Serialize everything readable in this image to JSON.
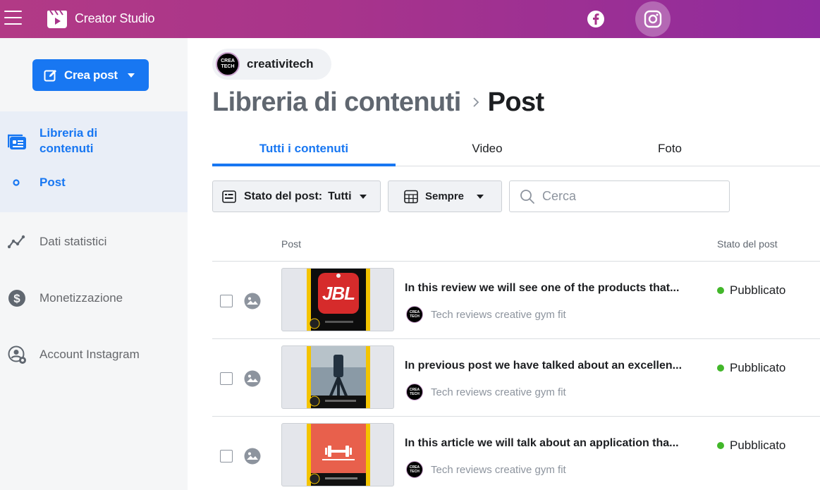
{
  "app": {
    "title": "Creator Studio"
  },
  "topbar": {
    "platforms": [
      "facebook-icon",
      "instagram-icon"
    ],
    "active_platform": "instagram"
  },
  "colors": {
    "topbar_start": "#b23a86",
    "topbar_end": "#8f2b9e",
    "accent": "#1877f2",
    "published": "#42b72a"
  },
  "sidebar": {
    "create_button": "Crea post",
    "items": [
      {
        "label": "Libreria di contenuti",
        "icon": "library-icon"
      },
      {
        "label": "Post",
        "icon": "dot-icon"
      },
      {
        "label": "Dati statistici",
        "icon": "insights-icon"
      },
      {
        "label": "Monetizzazione",
        "icon": "dollar-icon"
      },
      {
        "label": "Account Instagram",
        "icon": "account-settings-icon"
      }
    ]
  },
  "page": {
    "name": "creativitech",
    "avatar_text": "CREA TECH"
  },
  "breadcrumb": {
    "parent": "Libreria di contenuti",
    "current": "Post"
  },
  "tabs": [
    {
      "label": "Tutti i contenuti",
      "active": true
    },
    {
      "label": "Video",
      "active": false
    },
    {
      "label": "Foto",
      "active": false
    }
  ],
  "filters": {
    "status_label": "Stato del post:",
    "status_value": "Tutti",
    "date_value": "Sempre",
    "search_placeholder": "Cerca"
  },
  "table": {
    "columns": [
      "Post",
      "Stato del post"
    ],
    "rows": [
      {
        "title": "In this review we will see one of the products that...",
        "author": "Tech reviews creative gym fit",
        "status": "Pubblicato",
        "poster_text": "JBL"
      },
      {
        "title": "In previous post we have talked about an excellen...",
        "author": "Tech reviews creative gym fit",
        "status": "Pubblicato",
        "poster_text": ""
      },
      {
        "title": "In this article we will talk about an application tha...",
        "author": "Tech reviews creative gym fit",
        "status": "Pubblicato",
        "poster_text": ""
      }
    ]
  }
}
